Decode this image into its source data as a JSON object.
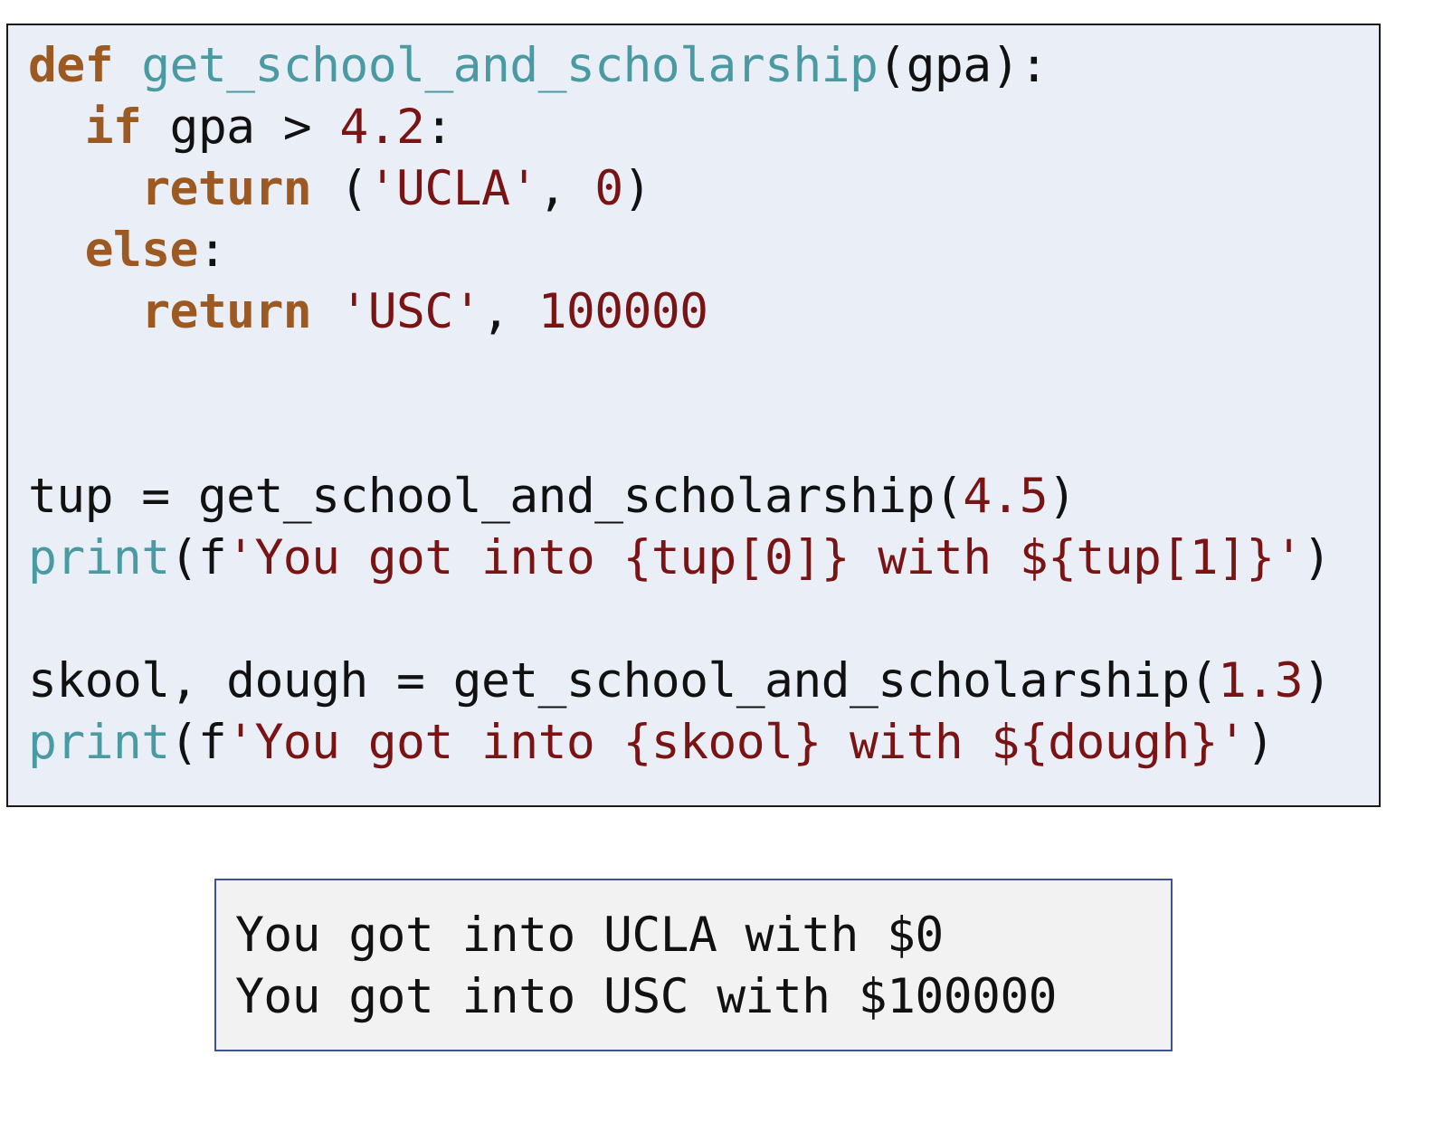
{
  "colors": {
    "keyword": "#9c5a22",
    "function_name": "#4a9aa3",
    "literal": "#7a1414",
    "default": "#111111",
    "code_background": "#e9eef7",
    "output_background": "#f2f2f2",
    "output_border": "#3d5494"
  },
  "code": {
    "lines": [
      [
        {
          "t": "def",
          "k": "kw",
          "bold": true
        },
        {
          "t": " ",
          "k": "plain"
        },
        {
          "t": "get_school_and_scholarship",
          "k": "fn"
        },
        {
          "t": "(gpa):",
          "k": "plain"
        }
      ],
      [
        {
          "t": "  ",
          "k": "plain"
        },
        {
          "t": "if",
          "k": "kw",
          "bold": true
        },
        {
          "t": " gpa > ",
          "k": "plain"
        },
        {
          "t": "4.2",
          "k": "lit"
        },
        {
          "t": ":",
          "k": "plain"
        }
      ],
      [
        {
          "t": "    ",
          "k": "plain"
        },
        {
          "t": "return",
          "k": "kw",
          "bold": true
        },
        {
          "t": " (",
          "k": "plain"
        },
        {
          "t": "'UCLA'",
          "k": "lit"
        },
        {
          "t": ", ",
          "k": "plain"
        },
        {
          "t": "0",
          "k": "lit"
        },
        {
          "t": ")",
          "k": "plain"
        }
      ],
      [
        {
          "t": "  ",
          "k": "plain"
        },
        {
          "t": "else",
          "k": "kw",
          "bold": true
        },
        {
          "t": ":",
          "k": "plain"
        }
      ],
      [
        {
          "t": "    ",
          "k": "plain"
        },
        {
          "t": "return",
          "k": "kw",
          "bold": true
        },
        {
          "t": " ",
          "k": "plain"
        },
        {
          "t": "'USC'",
          "k": "lit"
        },
        {
          "t": ", ",
          "k": "plain"
        },
        {
          "t": "100000",
          "k": "lit"
        }
      ],
      [],
      [],
      [
        {
          "t": "tup = get_school_and_scholarship(",
          "k": "plain"
        },
        {
          "t": "4.5",
          "k": "lit"
        },
        {
          "t": ")",
          "k": "plain"
        }
      ],
      [
        {
          "t": "print",
          "k": "fn"
        },
        {
          "t": "(f",
          "k": "plain"
        },
        {
          "t": "'You got into {tup[0]} with ${tup[1]}'",
          "k": "lit"
        },
        {
          "t": ")",
          "k": "plain"
        }
      ],
      [],
      [
        {
          "t": "skool, dough = get_school_and_scholarship(",
          "k": "plain"
        },
        {
          "t": "1.3",
          "k": "lit"
        },
        {
          "t": ")",
          "k": "plain"
        }
      ],
      [
        {
          "t": "print",
          "k": "fn"
        },
        {
          "t": "(f",
          "k": "plain"
        },
        {
          "t": "'You got into {skool} with ${dough}'",
          "k": "lit"
        },
        {
          "t": ")",
          "k": "plain"
        }
      ]
    ]
  },
  "output": {
    "line_1": "You got into UCLA with $0",
    "line_2": "You got into USC with $100000"
  }
}
